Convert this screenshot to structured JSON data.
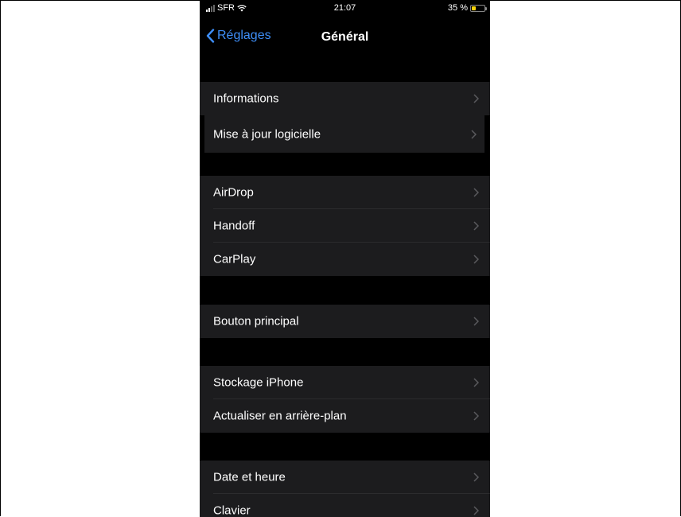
{
  "status_bar": {
    "carrier": "SFR",
    "time": "21:07",
    "battery_percent": "35 %",
    "battery_level": 0.35,
    "battery_color": "#f5d20a"
  },
  "nav": {
    "back_label": "Réglages",
    "title": "Général",
    "accent_color": "#3e8ef7"
  },
  "groups": [
    {
      "items": [
        {
          "label": "Informations"
        },
        {
          "label": "Mise à jour logicielle",
          "highlighted": true
        }
      ]
    },
    {
      "items": [
        {
          "label": "AirDrop"
        },
        {
          "label": "Handoff"
        },
        {
          "label": "CarPlay"
        }
      ]
    },
    {
      "items": [
        {
          "label": "Bouton principal"
        }
      ]
    },
    {
      "items": [
        {
          "label": "Stockage iPhone"
        },
        {
          "label": "Actualiser en arrière-plan"
        }
      ]
    },
    {
      "items": [
        {
          "label": "Date et heure"
        },
        {
          "label": "Clavier"
        }
      ]
    }
  ]
}
